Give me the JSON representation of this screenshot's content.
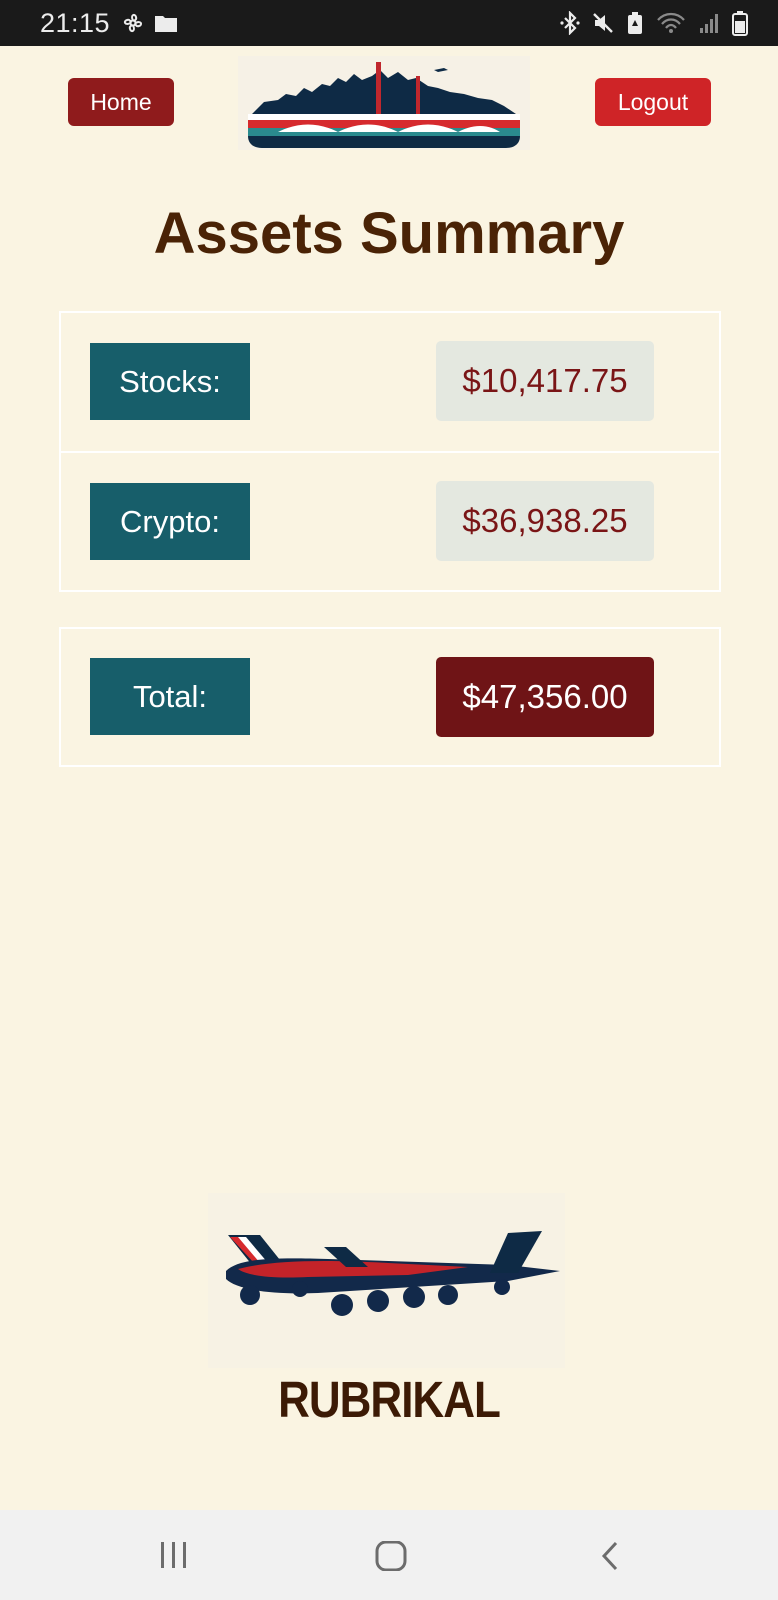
{
  "status_bar": {
    "time": "21:15",
    "left_icons": [
      "pinwheel-icon",
      "folder-icon"
    ],
    "right_icons": [
      "bluetooth-icon",
      "mute-icon",
      "battery-saver-icon",
      "wifi-icon",
      "signal-icon",
      "battery-icon"
    ]
  },
  "header": {
    "home_label": "Home",
    "logout_label": "Logout",
    "logo_icon": "city-skyline-logo"
  },
  "page": {
    "title": "Assets Summary"
  },
  "assets": {
    "rows": [
      {
        "label": "Stocks:",
        "value": "$10,417.75"
      },
      {
        "label": "Crypto:",
        "value": "$36,938.25"
      }
    ],
    "total": {
      "label": "Total:",
      "value": "$47,356.00"
    }
  },
  "footer": {
    "image_icon": "airplane-illustration",
    "brand": "RUBRIKAL"
  },
  "nav_bar": {
    "icons": [
      "recent-apps-icon",
      "home-circle-icon",
      "back-icon"
    ]
  },
  "colors": {
    "background": "#faf4e2",
    "label_bg": "#175e6a",
    "value_bg": "#e4e8e0",
    "value_text": "#7a1516",
    "total_bg": "#6f1416",
    "home_btn": "#8f1b1c",
    "logout_btn": "#cf2427",
    "title": "#4a2306"
  }
}
